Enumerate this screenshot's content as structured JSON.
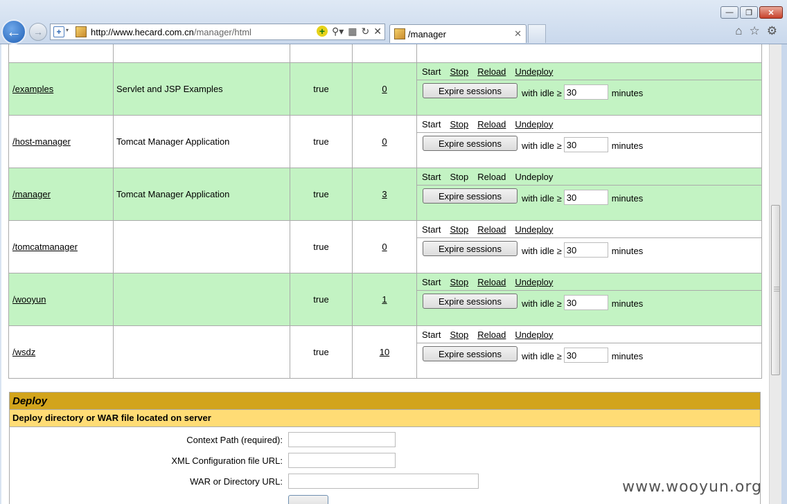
{
  "browser": {
    "url_host": "http://www.hecard.com.cn",
    "url_path": "/manager/html",
    "tab_title": "/manager",
    "window_controls": {
      "minimize": "—",
      "restore": "❐",
      "close": "✕"
    }
  },
  "apps_table": {
    "rows": [
      {
        "path": "/examples",
        "display_name": "Servlet and JSP Examples",
        "running": "true",
        "sessions": "0",
        "cmd_style": "all_links"
      },
      {
        "path": "/host-manager",
        "display_name": "Tomcat Manager Application",
        "running": "true",
        "sessions": "0",
        "cmd_style": "all_links"
      },
      {
        "path": "/manager",
        "display_name": "Tomcat Manager Application",
        "running": "true",
        "sessions": "3",
        "cmd_style": "no_links"
      },
      {
        "path": "/tomcatmanager",
        "display_name": "",
        "running": "true",
        "sessions": "0",
        "cmd_style": "all_links"
      },
      {
        "path": "/wooyun",
        "display_name": "",
        "running": "true",
        "sessions": "1",
        "cmd_style": "all_links"
      },
      {
        "path": "/wsdz",
        "display_name": "",
        "running": "true",
        "sessions": "10",
        "cmd_style": "all_links"
      }
    ],
    "commands": {
      "start": "Start",
      "stop": "Stop",
      "reload": "Reload",
      "undeploy": "Undeploy"
    },
    "expire_button": "Expire sessions",
    "idle_label": "with idle ≥",
    "idle_value": "30",
    "minutes_label": "minutes"
  },
  "deploy": {
    "title": "Deploy",
    "subtitle": "Deploy directory or WAR file located on server",
    "context_path_label": "Context Path (required):",
    "xml_config_label": "XML Configuration file URL:",
    "war_label": "WAR or Directory URL:"
  },
  "watermark": "www.wooyun.org"
}
